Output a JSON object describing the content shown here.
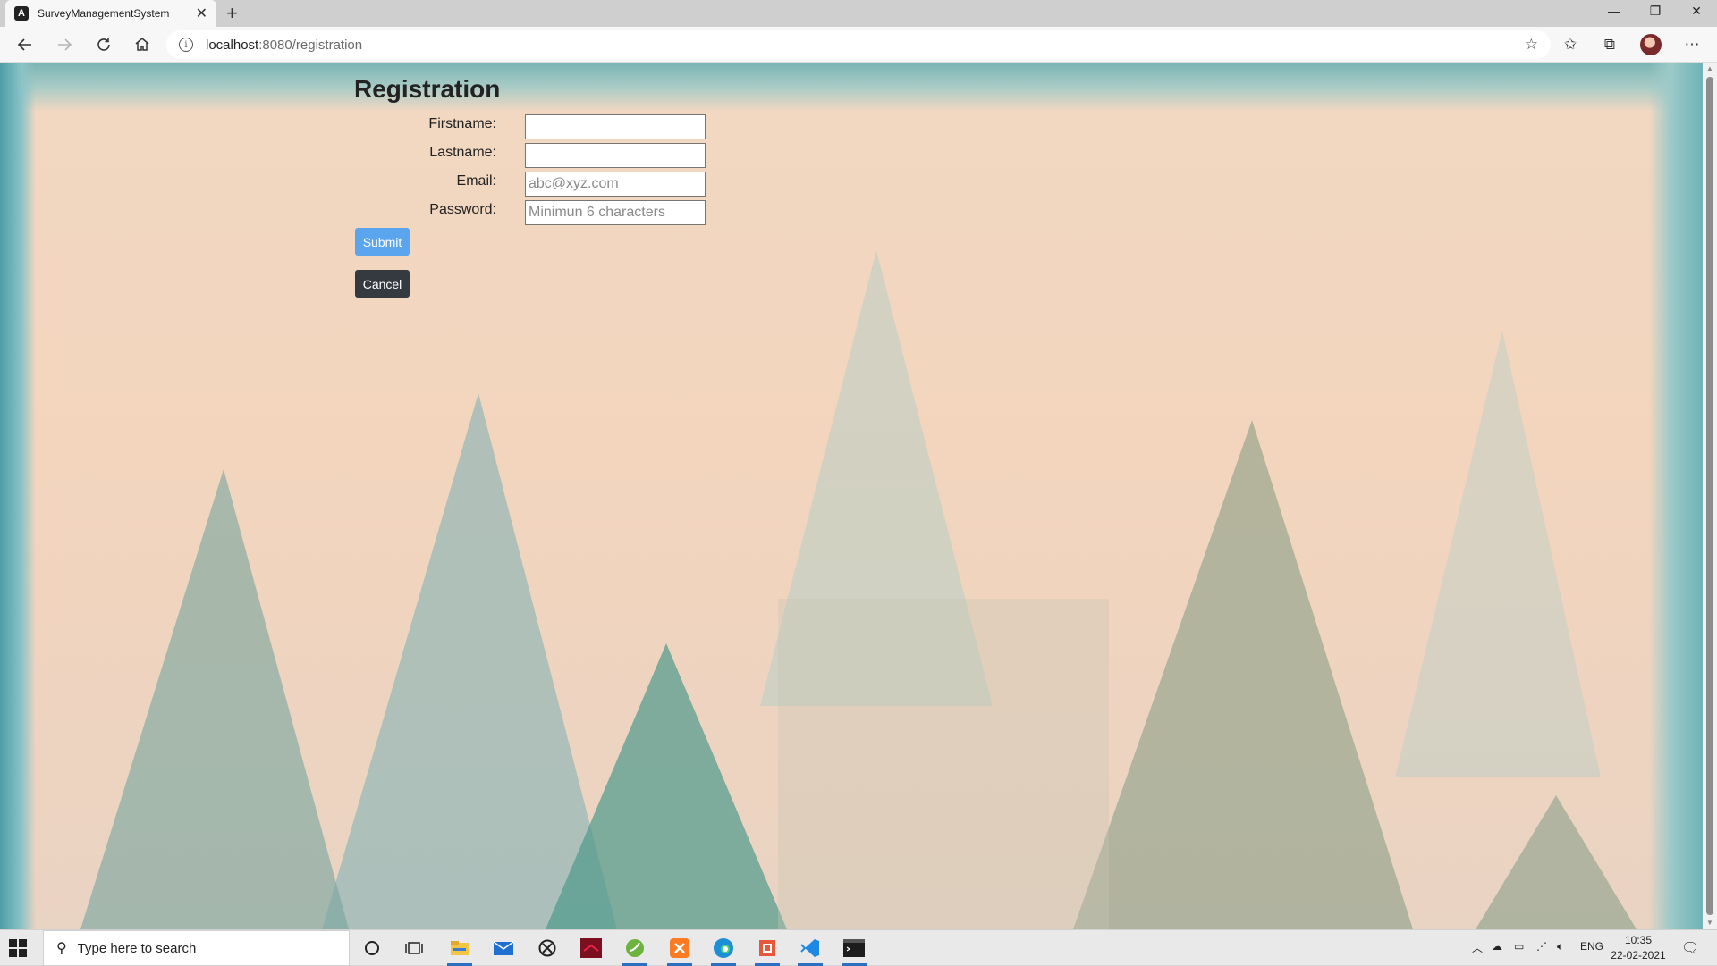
{
  "browser": {
    "tab_title": "SurveyManagementSystem",
    "tab_favicon_letter": "A",
    "new_tab": "+",
    "url_host": "localhost",
    "url_path": ":8080/registration"
  },
  "form": {
    "title": "Registration",
    "firstname_label": "Firstname:",
    "lastname_label": "Lastname:",
    "email_label": "Email:",
    "email_placeholder": "abc@xyz.com",
    "password_label": "Password:",
    "password_placeholder": "Minimun 6 characters",
    "submit_label": "Submit",
    "cancel_label": "Cancel"
  },
  "taskbar": {
    "search_placeholder": "Type here to search",
    "language": "ENG",
    "time": "10:35",
    "date": "22-02-2021",
    "apps": [
      "cortana-icon",
      "task-view-icon",
      "file-explorer-icon",
      "mail-icon",
      "xbox-icon",
      "app-red-icon",
      "spring-tool-icon",
      "xampp-icon",
      "edge-icon",
      "powerpoint-icon",
      "vscode-icon",
      "terminal-icon"
    ]
  },
  "colors": {
    "submit": "#5ba5ee",
    "cancel": "#343a40"
  }
}
